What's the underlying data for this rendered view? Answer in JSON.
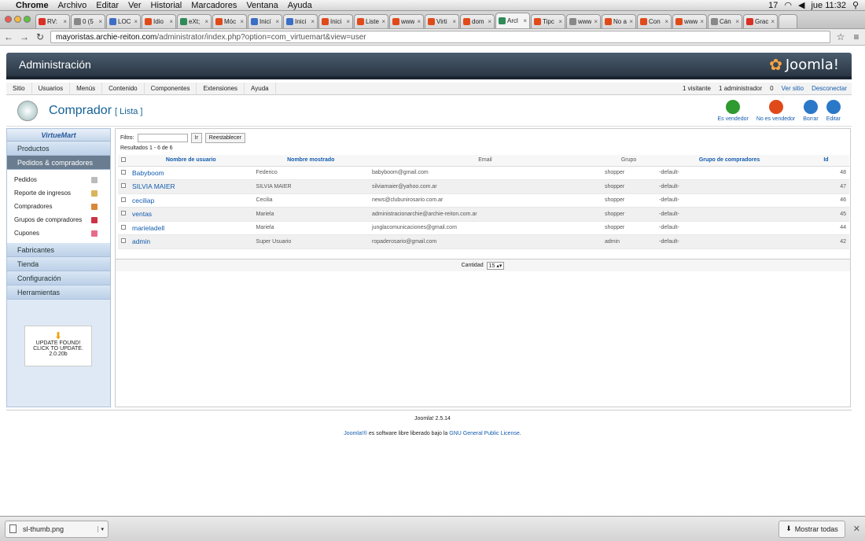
{
  "macbar": {
    "app": "Chrome",
    "menus": [
      "Archivo",
      "Editar",
      "Ver",
      "Historial",
      "Marcadores",
      "Ventana",
      "Ayuda"
    ],
    "status": {
      "indicator": "17",
      "clock": "jue 11:32"
    }
  },
  "tabs": [
    {
      "label": "RV:",
      "color": "#d93025"
    },
    {
      "label": "0 (5",
      "color": "#888"
    },
    {
      "label": "LOC",
      "color": "#3b6ec5"
    },
    {
      "label": "Idio",
      "color": "#e04a1a"
    },
    {
      "label": "eXt;",
      "color": "#2e8b57"
    },
    {
      "label": "Móc",
      "color": "#e04a1a"
    },
    {
      "label": "Inicí",
      "color": "#3b6ec5"
    },
    {
      "label": "Inici",
      "color": "#3b6ec5"
    },
    {
      "label": "Inici",
      "color": "#e04a1a"
    },
    {
      "label": "Liste",
      "color": "#e04a1a"
    },
    {
      "label": "www",
      "color": "#e04a1a"
    },
    {
      "label": "Virti",
      "color": "#e04a1a"
    },
    {
      "label": "dom",
      "color": "#e04a1a"
    },
    {
      "label": "Arcl",
      "color": "#2e8b57",
      "active": true
    },
    {
      "label": "Tipc",
      "color": "#e04a1a"
    },
    {
      "label": "www",
      "color": "#888"
    },
    {
      "label": "No a",
      "color": "#e04a1a"
    },
    {
      "label": "Con",
      "color": "#e04a1a"
    },
    {
      "label": "www",
      "color": "#e04a1a"
    },
    {
      "label": "Cán",
      "color": "#888"
    },
    {
      "label": "Grac",
      "color": "#d93025"
    }
  ],
  "url": {
    "host": "mayoristas.archie-reiton.com",
    "path": "/administrator/index.php?option=com_virtuemart&view=user"
  },
  "admin": {
    "title": "Administración",
    "logo": "Joomla!"
  },
  "submenu": {
    "items": [
      "Sitio",
      "Usuarios",
      "Menús",
      "Contenido",
      "Componentes",
      "Extensiones",
      "Ayuda"
    ],
    "visitors": "1 visitante",
    "admins": "1 administrador",
    "messages": "0",
    "view_site": "Ver sitio",
    "logout": "Desconectar"
  },
  "toolbar": {
    "title": "Comprador",
    "subtitle": "[ Lista ]",
    "tools": [
      {
        "label": "Es vendedor",
        "color": "#2f9a2f"
      },
      {
        "label": "No es vendedor",
        "color": "#e04a1a"
      },
      {
        "label": "Borrar",
        "color": "#2a78c8"
      },
      {
        "label": "Editar",
        "color": "#2a78c8"
      }
    ]
  },
  "sidebar": {
    "brand": "VirtueMart",
    "top": [
      "Productos",
      "Pedidos & compradores"
    ],
    "sub": [
      {
        "label": "Pedidos",
        "color": "#bbb"
      },
      {
        "label": "Reporte de ingresos",
        "color": "#d9b45a"
      },
      {
        "label": "Compradores",
        "color": "#d9883a"
      },
      {
        "label": "Grupos de compradores",
        "color": "#c34"
      },
      {
        "label": "Cupones",
        "color": "#e86a8a"
      }
    ],
    "bottom": [
      "Fabricantes",
      "Tienda",
      "Configuración",
      "Herramientas"
    ],
    "update": {
      "line1": "UPDATE FOUND!",
      "line2": "CLICK TO UPDATE.",
      "version": "2.0.20b"
    }
  },
  "filter": {
    "label": "Filtro:",
    "value": "",
    "go": "Ir",
    "reset": "Reestablecer",
    "results": "Resultados 1 - 6 de 6"
  },
  "table": {
    "headers": [
      "Nombre de usuario",
      "Nombre mostrado",
      "Email",
      "Grupo",
      "Grupo de compradores",
      "Id"
    ],
    "rows": [
      [
        "Babyboom",
        "Federico",
        "babyboom@gmail.com",
        "shopper",
        "-default-",
        "48"
      ],
      [
        "SILVIA MAIER",
        "SILVIA MAIER",
        "silviamaier@yahoo.com.ar",
        "shopper",
        "-default-",
        "47"
      ],
      [
        "ceciliap",
        "Cecilia",
        "news@clubunirosario.com.ar",
        "shopper",
        "-default-",
        "46"
      ],
      [
        "ventas",
        "Mariela",
        "administracionarchie@archie-reiton.com.ar",
        "shopper",
        "-default-",
        "45"
      ],
      [
        "marieladell",
        "Mariela",
        "junglacomunicaciones@gmail.com",
        "shopper",
        "-default-",
        "44"
      ],
      [
        "admin",
        "Super Usuario",
        "ropaderosario@gmail.com",
        "admin",
        "-default-",
        "42"
      ]
    ]
  },
  "pager": {
    "label": "Cantidad",
    "value": "15"
  },
  "footer": {
    "version": "Joomla! 2.5.14",
    "license_pre": "Joomla!®",
    "license_mid": " es software libre liberado bajo la ",
    "license_link": "GNU General Public License",
    "license_end": "."
  },
  "downloads": {
    "file": "sl-thumb.png",
    "show_all": "Mostrar todas"
  }
}
